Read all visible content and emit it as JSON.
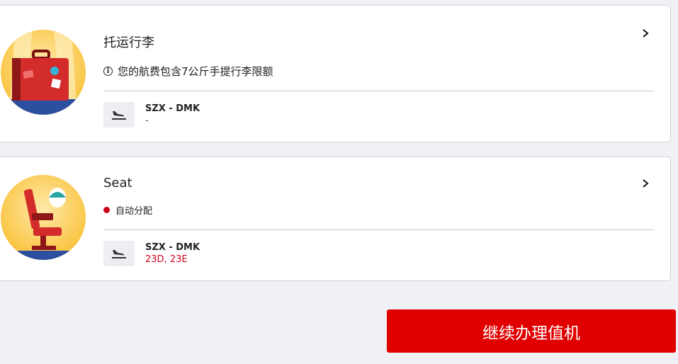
{
  "baggage": {
    "title": "托运行李",
    "info": "您的航费包含7公斤手提行李限额",
    "route": "SZX - DMK",
    "detail": "-",
    "icon": "baggage-illustration"
  },
  "seat": {
    "title": "Seat",
    "status": "自动分配",
    "route": "SZX - DMK",
    "detail": "23D, 23E",
    "icon": "seat-illustration"
  },
  "continue_label": "继续办理值机",
  "colors": {
    "accent": "#e00000",
    "status_dot": "#d0021b",
    "seat_text": "#d0021b"
  }
}
